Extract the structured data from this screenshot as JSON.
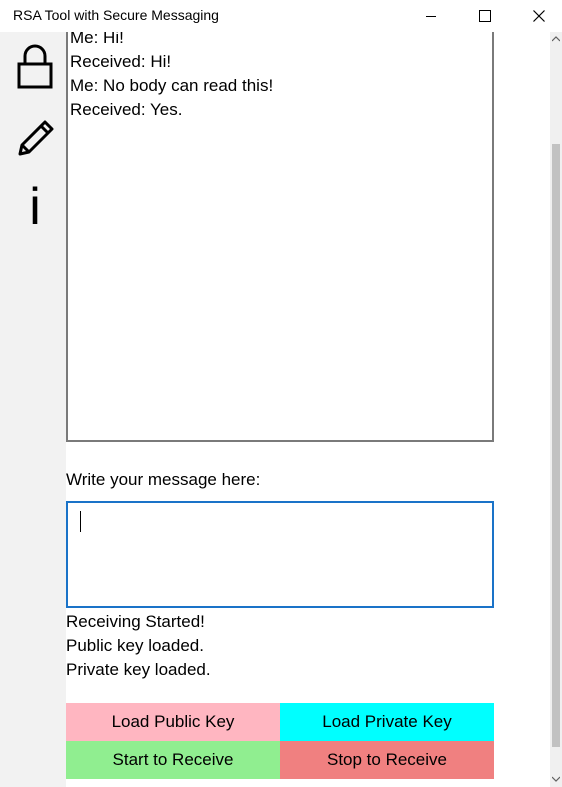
{
  "window": {
    "title": "RSA Tool with Secure Messaging"
  },
  "sidebar": {
    "items": [
      {
        "icon": "lock-icon"
      },
      {
        "icon": "pencil-icon"
      },
      {
        "icon": "info-icon",
        "glyph": "i"
      }
    ]
  },
  "chat": {
    "lines": [
      "Me: Hi!",
      "Received: Hi!",
      "Me: No body can read this!",
      "Received: Yes."
    ]
  },
  "compose": {
    "label": "Write your message here:",
    "value": ""
  },
  "status": {
    "lines": [
      "Receiving Started!",
      "Public key loaded.",
      "Private key loaded."
    ]
  },
  "buttons": {
    "load_public": {
      "label": "Load Public Key",
      "color": "#ffb6c1"
    },
    "load_private": {
      "label": "Load Private Key",
      "color": "#00ffff"
    },
    "start_receive": {
      "label": "Start to Receive",
      "color": "#90ee90"
    },
    "stop_receive": {
      "label": "Stop to Receive",
      "color": "#f08080"
    }
  }
}
